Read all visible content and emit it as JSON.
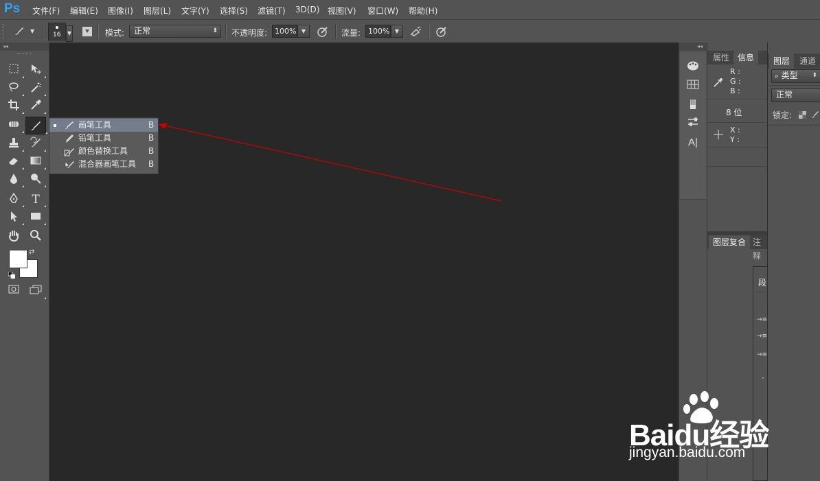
{
  "app": {
    "logo": "Ps"
  },
  "menubar": {
    "items": [
      {
        "label": "文件(F)"
      },
      {
        "label": "编辑(E)"
      },
      {
        "label": "图像(I)"
      },
      {
        "label": "图层(L)"
      },
      {
        "label": "文字(Y)"
      },
      {
        "label": "选择(S)"
      },
      {
        "label": "滤镜(T)"
      },
      {
        "label": "3D(D)"
      },
      {
        "label": "视图(V)"
      },
      {
        "label": "窗口(W)"
      },
      {
        "label": "帮助(H)"
      }
    ]
  },
  "options": {
    "brush_size": "16",
    "mode_label": "模式:",
    "mode_value": "正常",
    "opacity_label": "不透明度:",
    "opacity_value": "100%",
    "flow_label": "流量:",
    "flow_value": "100%"
  },
  "flyout": {
    "items": [
      {
        "label": "画笔工具",
        "shortcut": "B",
        "icon": "brush-icon",
        "selected": true
      },
      {
        "label": "铅笔工具",
        "shortcut": "B",
        "icon": "pencil-icon",
        "selected": false
      },
      {
        "label": "颜色替换工具",
        "shortcut": "B",
        "icon": "color-replace-icon",
        "selected": false
      },
      {
        "label": "混合器画笔工具",
        "shortcut": "B",
        "icon": "mixer-brush-icon",
        "selected": false
      }
    ]
  },
  "info_panel": {
    "tabs": [
      {
        "label": "属性"
      },
      {
        "label": "信息"
      }
    ],
    "r": "R :",
    "g": "G :",
    "b": "B :",
    "bits": "8 位",
    "x": "X :",
    "y": "Y :"
  },
  "layer_comps": {
    "tabs": [
      {
        "label": "图层复合"
      },
      {
        "label": "注释"
      }
    ]
  },
  "layers_panel": {
    "tabs": [
      {
        "label": "图层"
      },
      {
        "label": "通道"
      }
    ],
    "filter": "类型",
    "blend_mode": "正常",
    "lock_label": "锁定:"
  },
  "paragraph_panel": {
    "title": "段"
  },
  "watermark": {
    "brand": "Baidu经验",
    "url": "jingyan.baidu.com"
  },
  "colors": {
    "annotation_arrow": "#cc0000",
    "ps_logo": "#2fa3f6",
    "flyout_selected": "#737d8c"
  }
}
